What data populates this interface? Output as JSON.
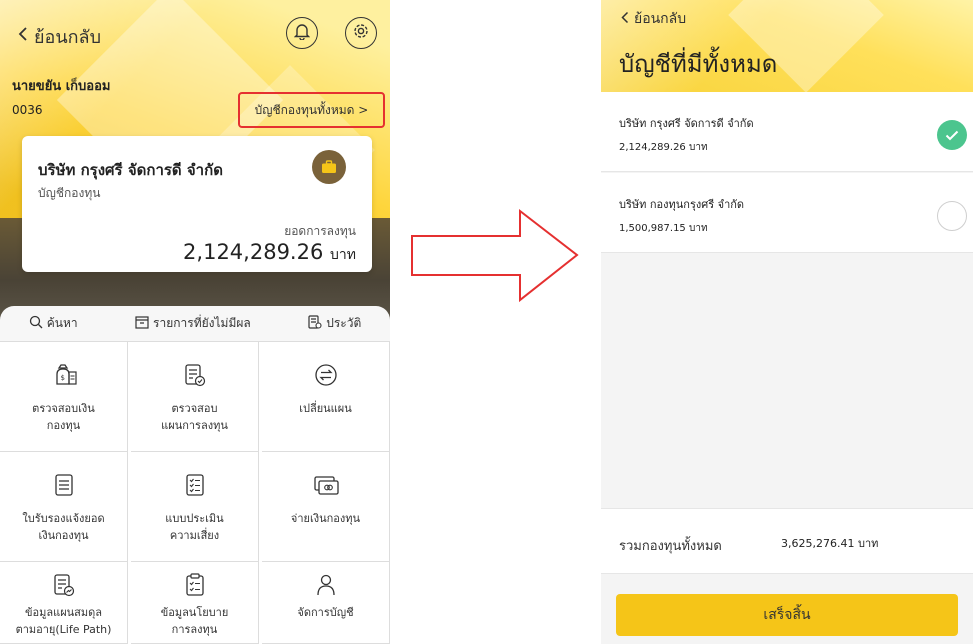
{
  "left": {
    "back_label": "ย้อนกลับ",
    "user_name": "นายขยัน เก็บออม",
    "account_no": "0036",
    "all_funds_link": "บัญชีกองทุนทั้งหมด >",
    "card": {
      "company": "บริษัท กรุงศรี จัดการดี จำกัด",
      "account_type": "บัญชีกองทุน",
      "investment_label": "ยอดการลงทุน",
      "investment_amount": "2,124,289.26",
      "currency": "บาท"
    },
    "tabs": [
      {
        "label": "ค้นหา",
        "icon": "search-icon"
      },
      {
        "label": "รายการที่ยังไม่มีผล",
        "icon": "pending-box-icon"
      },
      {
        "label": "ประวัติ",
        "icon": "history-icon"
      }
    ],
    "menu": [
      {
        "line1": "ตรวจสอบเงิน",
        "line2": "กองทุน",
        "icon": "money-bag-icon"
      },
      {
        "line1": "ตรวจสอบ",
        "line2": "แผนการลงทุน",
        "icon": "document-check-icon"
      },
      {
        "line1": "เปลี่ยนแผน",
        "line2": "",
        "icon": "swap-arrows-icon"
      },
      {
        "line1": "ใบรับรองแจ้งยอด",
        "line2": "เงินกองทุน",
        "icon": "certificate-icon"
      },
      {
        "line1": "แบบประเมิน",
        "line2": "ความเสี่ยง",
        "icon": "checklist-icon"
      },
      {
        "line1": "จ่ายเงินกองทุน",
        "line2": "",
        "icon": "payment-card-icon"
      },
      {
        "line1": "ข้อมูลแผนสมดุล",
        "line2": "ตามอายุ(Life Path)",
        "icon": "document-chart-icon"
      },
      {
        "line1": "ข้อมูลนโยบาย",
        "line2": "การลงทุน",
        "icon": "clipboard-icon"
      },
      {
        "line1": "จัดการบัญชี",
        "line2": "",
        "icon": "user-icon"
      }
    ]
  },
  "right": {
    "back_label": "ย้อนกลับ",
    "title": "บัญชีที่มีทั้งหมด",
    "accounts": [
      {
        "name": "บริษัท กรุงศรี จัดการดี จำกัด",
        "amount": "2,124,289.26 บาท",
        "selected": true
      },
      {
        "name": "บริษัท กองทุนกรุงศรี จำกัด",
        "amount": "1,500,987.15 บาท",
        "selected": false
      }
    ],
    "total_label": "รวมกองทุนทั้งหมด",
    "total_value": "3,625,276.41 บาท",
    "done_label": "เสร็จสิ้น"
  },
  "colors": {
    "brand_yellow": "#f5c518",
    "highlight_red": "#e53030",
    "check_green": "#4cc58e"
  }
}
